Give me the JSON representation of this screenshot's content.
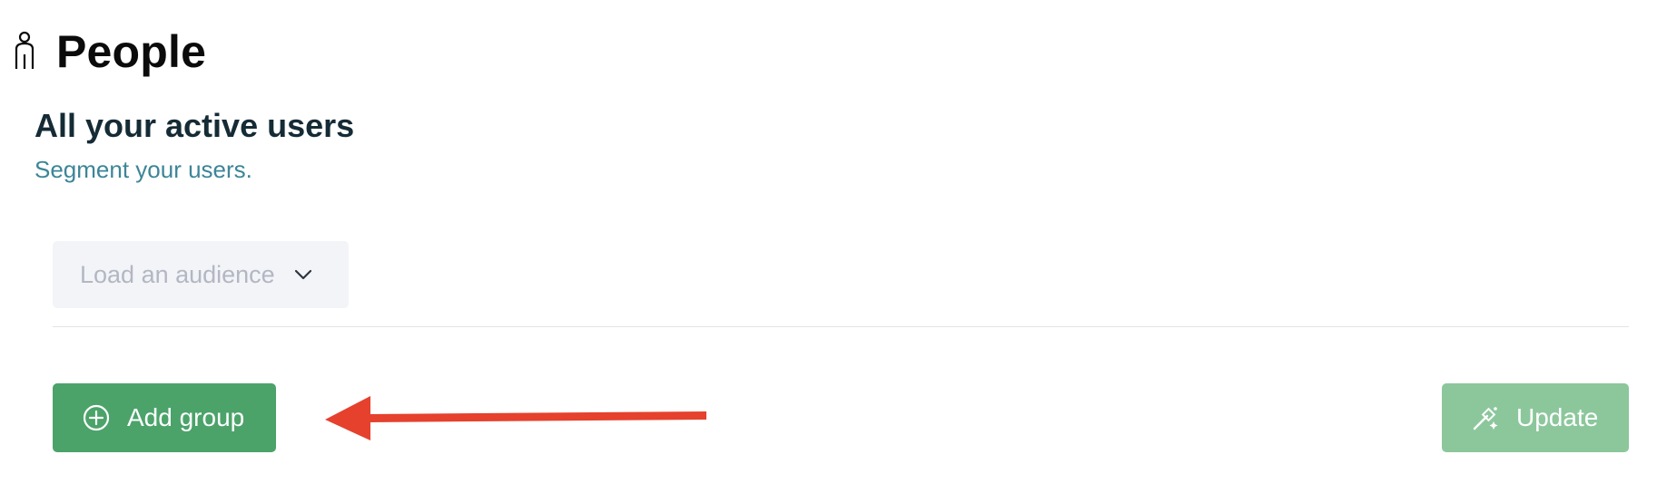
{
  "header": {
    "icon": "person-icon",
    "title": "People"
  },
  "section": {
    "title": "All your active users",
    "subtitle": "Segment your users."
  },
  "audience_select": {
    "label": "Load an audience",
    "icon": "chevron-down-icon"
  },
  "actions": {
    "add_group_label": "Add group",
    "add_group_icon": "plus-circle-icon",
    "update_label": "Update",
    "update_icon": "magic-wand-icon"
  },
  "colors": {
    "primary_green": "#4ba36a",
    "disabled_green": "#8cc79c",
    "subtitle_teal": "#3d8598",
    "annotation_red": "#e5412d"
  }
}
